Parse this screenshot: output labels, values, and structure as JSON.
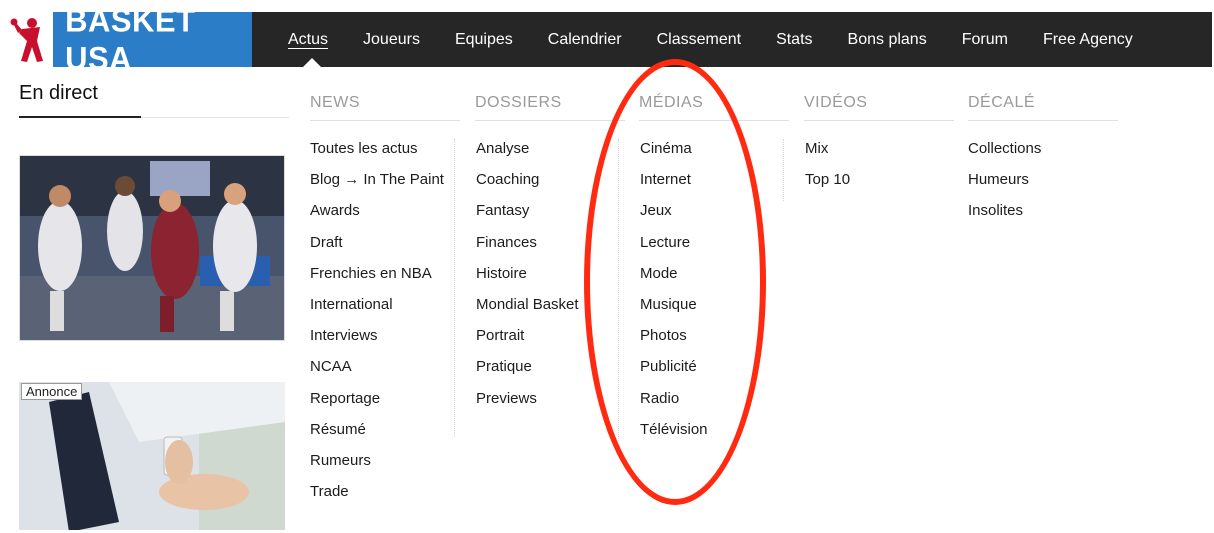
{
  "header": {
    "logo_text": "BASKET USA",
    "nav": [
      "Actus",
      "Joueurs",
      "Equipes",
      "Calendrier",
      "Classement",
      "Stats",
      "Bons plans",
      "Forum",
      "Free Agency"
    ]
  },
  "sidebar": {
    "live_tab": "En direct",
    "ad_label": "Annonce"
  },
  "menu": {
    "columns": [
      {
        "title": "NEWS",
        "items": [
          "Toutes les actus",
          "Blog → In The Paint",
          "Awards",
          "Draft",
          "Frenchies en NBA",
          "International",
          "Interviews",
          "NCAA",
          "Reportage",
          "Résumé",
          "Rumeurs",
          "Trade"
        ]
      },
      {
        "title": "DOSSIERS",
        "items": [
          "Analyse",
          "Coaching",
          "Fantasy",
          "Finances",
          "Histoire",
          "Mondial Basket",
          "Portrait",
          "Pratique",
          "Previews"
        ]
      },
      {
        "title": "MÉDIAS",
        "items": [
          "Cinéma",
          "Internet",
          "Jeux",
          "Lecture",
          "Mode",
          "Musique",
          "Photos",
          "Publicité",
          "Radio",
          "Télévision"
        ]
      },
      {
        "title": "VIDÉOS",
        "items": [
          "Mix",
          "Top 10"
        ]
      },
      {
        "title": "DÉCALÉ",
        "items": [
          "Collections",
          "Humeurs",
          "Insolites"
        ]
      }
    ]
  },
  "colors": {
    "topbar": "#262626",
    "logo_bg": "#2a7dc6",
    "annotation": "#ff2a10"
  }
}
